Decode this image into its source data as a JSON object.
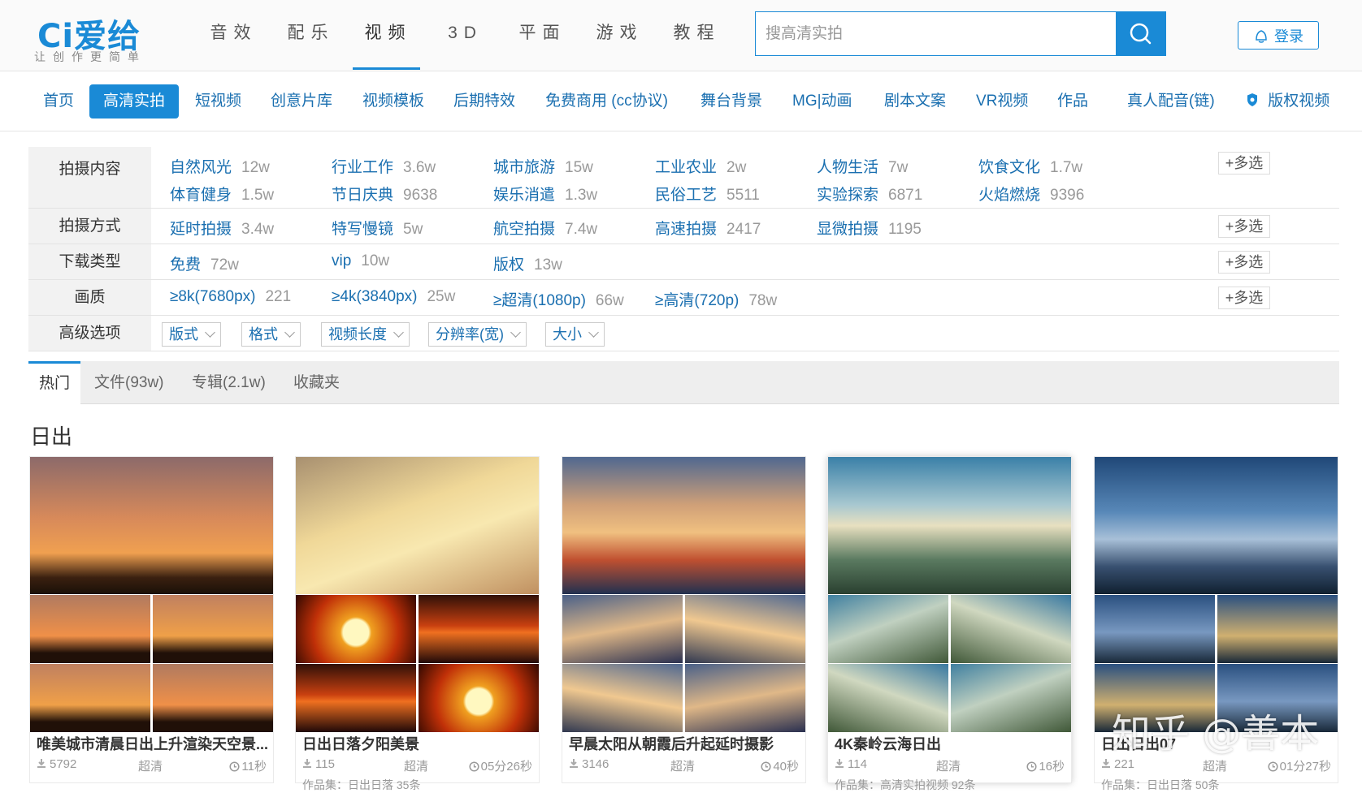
{
  "logo": {
    "brand": "Ci爱给",
    "slogan": "让创作更简单"
  },
  "top_nav": [
    "音效",
    "配乐",
    "视频",
    "3D",
    "平面",
    "游戏",
    "教程"
  ],
  "top_nav_active": "视频",
  "search": {
    "placeholder": "搜高清实拍"
  },
  "login": {
    "label": "登录"
  },
  "category_nav": [
    "首页",
    "高清实拍",
    "短视频",
    "创意片库",
    "视频模板",
    "后期特效",
    "免费商用 (cc协议)",
    "舞台背景",
    "MG|动画",
    "剧本文案",
    "VR视频",
    "作品",
    "真人配音(链)",
    "版权视频"
  ],
  "category_active": "高清实拍",
  "filters": {
    "content": {
      "label": "拍摄内容",
      "options": [
        {
          "name": "自然风光",
          "count": "12w"
        },
        {
          "name": "行业工作",
          "count": "3.6w"
        },
        {
          "name": "城市旅游",
          "count": "15w"
        },
        {
          "name": "工业农业",
          "count": "2w"
        },
        {
          "name": "人物生活",
          "count": "7w"
        },
        {
          "name": "饮食文化",
          "count": "1.7w"
        },
        {
          "name": "体育健身",
          "count": "1.5w"
        },
        {
          "name": "节日庆典",
          "count": "9638"
        },
        {
          "name": "娱乐消遣",
          "count": "1.3w"
        },
        {
          "name": "民俗工艺",
          "count": "5511"
        },
        {
          "name": "实验探索",
          "count": "6871"
        },
        {
          "name": "火焰燃烧",
          "count": "9396"
        }
      ]
    },
    "method": {
      "label": "拍摄方式",
      "options": [
        {
          "name": "延时拍摄",
          "count": "3.4w"
        },
        {
          "name": "特写慢镜",
          "count": "5w"
        },
        {
          "name": "航空拍摄",
          "count": "7.4w"
        },
        {
          "name": "高速拍摄",
          "count": "2417"
        },
        {
          "name": "显微拍摄",
          "count": "1195"
        }
      ]
    },
    "download": {
      "label": "下载类型",
      "options": [
        {
          "name": "免费",
          "count": "72w"
        },
        {
          "name": "vip",
          "count": "10w"
        },
        {
          "name": "版权",
          "count": "13w"
        }
      ]
    },
    "quality": {
      "label": "画质",
      "options": [
        {
          "name": "≥8k(7680px)",
          "count": "221"
        },
        {
          "name": "≥4k(3840px)",
          "count": "25w"
        },
        {
          "name": "≥超清(1080p)",
          "count": "66w"
        },
        {
          "name": "≥高清(720p)",
          "count": "78w"
        }
      ]
    },
    "advanced": {
      "label": "高级选项",
      "dropdowns": [
        "版式",
        "格式",
        "视频长度",
        "分辨率(宽)",
        "大小"
      ]
    },
    "more_label": "多选"
  },
  "tabs": [
    "热门",
    "文件(93w)",
    "专辑(2.1w)",
    "收藏夹"
  ],
  "tab_active": "热门",
  "section_title": "日出",
  "cards": [
    {
      "title": "唯美城市清晨日出上升渲染天空景...",
      "downloads": "5792",
      "quality": "超清",
      "duration": "11秒",
      "author": ""
    },
    {
      "title": "日出日落夕阳美景",
      "downloads": "115",
      "quality": "超清",
      "duration": "05分26秒",
      "author": "作品集：日出日落 35条"
    },
    {
      "title": "早晨太阳从朝霞后升起延时摄影",
      "downloads": "3146",
      "quality": "超清",
      "duration": "40秒",
      "author": ""
    },
    {
      "title": "4K秦岭云海日出",
      "downloads": "114",
      "quality": "超清",
      "duration": "16秒",
      "author": "作品集：高清实拍视频 92条"
    },
    {
      "title": "日出日出07",
      "downloads": "221",
      "quality": "超清",
      "duration": "01分27秒",
      "author": "作品集：日出日落 50条"
    }
  ],
  "watermark": "知乎 @善本",
  "colors": {
    "accent": "#1a8ad6",
    "link": "#1a6fb0"
  }
}
